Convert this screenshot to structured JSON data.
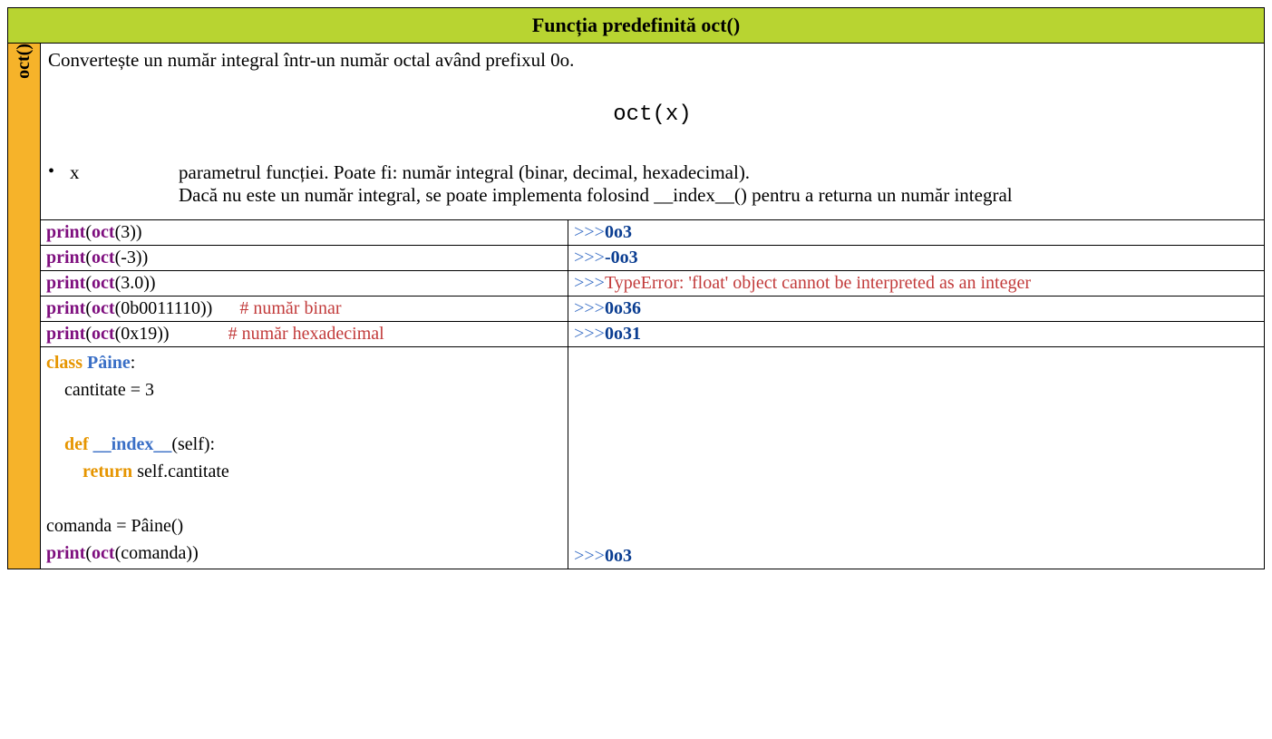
{
  "header": {
    "title": "Funcția predefinită oct()"
  },
  "sidebar": {
    "label": "oct()"
  },
  "description": {
    "paragraph": "Convertește un număr integral într-un număr octal având prefixul 0o.",
    "signature": "oct(x)",
    "param": {
      "name": "x",
      "desc_line1": "parametrul funcției. Poate fi: număr integral (binar, decimal, hexadecimal).",
      "desc_line2": "Dacă nu este un număr integral, se poate implementa folosind __index__() pentru a returna un număr integral"
    }
  },
  "rows": [
    {
      "code": {
        "kw1": "print",
        "kw2": "oct",
        "arg": "3"
      },
      "output": {
        "type": "ok",
        "prompt": ">>>",
        "value": "0o3"
      }
    },
    {
      "code": {
        "kw1": "print",
        "kw2": "oct",
        "arg": "-3"
      },
      "output": {
        "type": "neg",
        "prompt": ">>>",
        "neg": "-",
        "value": "0o3"
      }
    },
    {
      "code": {
        "kw1": "print",
        "kw2": "oct",
        "arg": "3.0"
      },
      "output": {
        "type": "error",
        "prompt": ">>>",
        "err": "TypeError: 'float' object cannot be interpreted as an integer"
      }
    },
    {
      "code": {
        "kw1": "print",
        "kw2": "oct",
        "arg": "0b0011110",
        "comment": "# număr binar",
        "pad": "      "
      },
      "output": {
        "type": "ok",
        "prompt": ">>>",
        "value": "0o36"
      }
    },
    {
      "code": {
        "kw1": "print",
        "kw2": "oct",
        "arg": "0x19",
        "comment": "# număr hexadecimal",
        "pad": "             "
      },
      "output": {
        "type": "ok",
        "prompt": ">>>",
        "value": "0o31"
      }
    }
  ],
  "class_row": {
    "code": {
      "class_kw": "class",
      "class_name": "Pâine",
      "colon": ":",
      "body_line1": "    cantitate = 3",
      "blank": "",
      "def_kw": "def",
      "method_name": "__index__",
      "def_rest": "(self):",
      "return_kw": "return",
      "return_rest": " self.cantitate",
      "assign_line": "comanda = Pâine()",
      "print_kw": "print",
      "oct_kw": "oct",
      "print_arg": "comanda"
    },
    "output": {
      "prompt": ">>>",
      "value": "0o3"
    }
  }
}
